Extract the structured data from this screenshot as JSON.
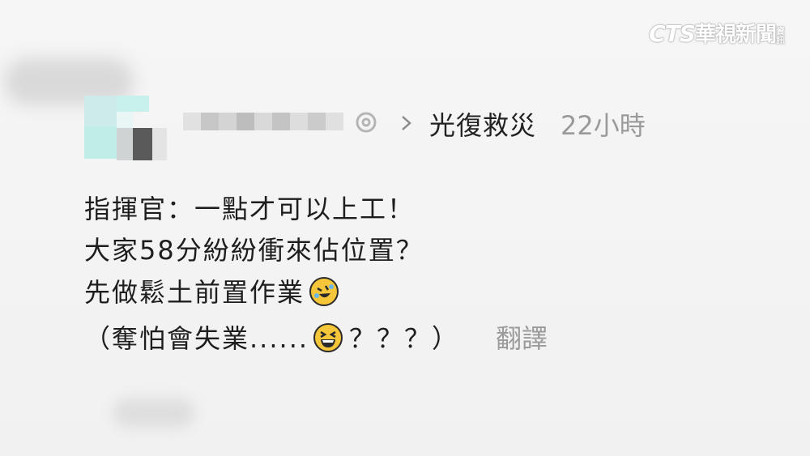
{
  "watermark": {
    "brand": "CTS",
    "name": "華視新聞",
    "small": "資訊"
  },
  "post": {
    "group_name": "光復救災",
    "time_ago": "22小時",
    "lines": [
      "指揮官：一點才可以上工！",
      "大家58分紛紛衝來佔位置？",
      "先做鬆土前置作業",
      "（奪怕會失業......"
    ],
    "line4_suffix": "？？？）",
    "translate_label": "翻譯"
  },
  "icons": {
    "avatar": "blurred-avatar",
    "verified": "verified-badge-icon",
    "chevron": "chevron-right-icon",
    "emoji1": "rolling-laughing-emoji",
    "emoji2": "grinning-squint-emoji"
  },
  "colors": {
    "text": "#1e1e1e",
    "muted": "#9a9a9a",
    "emoji": "#f6c63a",
    "avatar_teal": "#bfeee8"
  }
}
